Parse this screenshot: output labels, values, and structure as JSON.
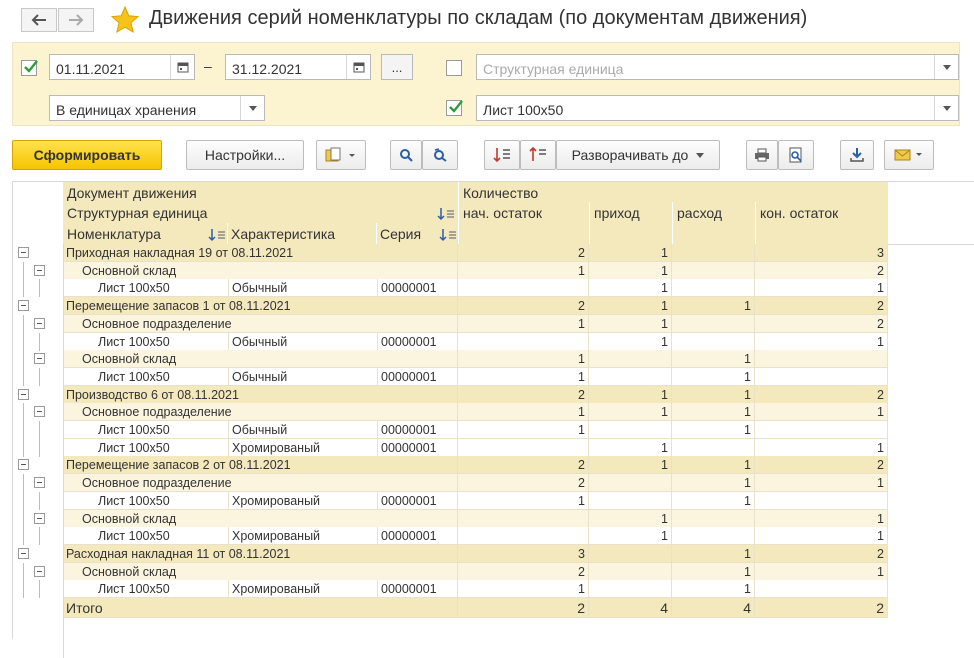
{
  "window": {
    "title": "Движения серий номенклатуры по складам (по документам движения)"
  },
  "filters": {
    "period_enabled": true,
    "date_from": "01.11.2021",
    "date_to": "31.12.2021",
    "period_dash": "–",
    "period_button": "...",
    "units": "В единицах хранения",
    "structural_unit_enabled": false,
    "structural_unit_placeholder": "Структурная единица",
    "item_enabled": true,
    "item_value": "Лист 100х50"
  },
  "toolbar": {
    "generate": "Сформировать",
    "settings": "Настройки...",
    "expand_to": "Разворачивать до"
  },
  "report": {
    "headers": {
      "document": "Документ движения",
      "structural_unit": "Структурная единица",
      "nomenclature": "Номенклатура",
      "characteristic": "Характеристика",
      "series": "Серия",
      "quantity": "Количество",
      "start_balance": "нач. остаток",
      "income": "приход",
      "expense": "расход",
      "end_balance": "кон. остаток"
    },
    "rows": [
      {
        "level": 0,
        "name": "Приходная накладная 19 от 08.11.2021",
        "char": "",
        "series": "",
        "start": "2",
        "income": "1",
        "expense": "",
        "end": "3"
      },
      {
        "level": 1,
        "name": "Основной склад",
        "char": "",
        "series": "",
        "start": "1",
        "income": "1",
        "expense": "",
        "end": "2"
      },
      {
        "level": 2,
        "name": "Лист 100х50",
        "char": "Обычный",
        "series": "00000001",
        "start": "",
        "income": "1",
        "expense": "",
        "end": "1"
      },
      {
        "level": 0,
        "name": "Перемещение запасов 1 от 08.11.2021",
        "char": "",
        "series": "",
        "start": "2",
        "income": "1",
        "expense": "1",
        "end": "2"
      },
      {
        "level": 1,
        "name": "Основное подразделение",
        "char": "",
        "series": "",
        "start": "1",
        "income": "1",
        "expense": "",
        "end": "2"
      },
      {
        "level": 2,
        "name": "Лист 100х50",
        "char": "Обычный",
        "series": "00000001",
        "start": "",
        "income": "1",
        "expense": "",
        "end": "1"
      },
      {
        "level": 1,
        "name": "Основной склад",
        "char": "",
        "series": "",
        "start": "1",
        "income": "",
        "expense": "1",
        "end": ""
      },
      {
        "level": 2,
        "name": "Лист 100х50",
        "char": "Обычный",
        "series": "00000001",
        "start": "1",
        "income": "",
        "expense": "1",
        "end": ""
      },
      {
        "level": 0,
        "name": "Производство 6 от 08.11.2021",
        "char": "",
        "series": "",
        "start": "2",
        "income": "1",
        "expense": "1",
        "end": "2"
      },
      {
        "level": 1,
        "name": "Основное подразделение",
        "char": "",
        "series": "",
        "start": "1",
        "income": "1",
        "expense": "1",
        "end": "1"
      },
      {
        "level": 2,
        "name": "Лист 100х50",
        "char": "Обычный",
        "series": "00000001",
        "start": "1",
        "income": "",
        "expense": "1",
        "end": ""
      },
      {
        "level": 2,
        "name": "Лист 100х50",
        "char": "Хромированый",
        "series": "00000001",
        "start": "",
        "income": "1",
        "expense": "",
        "end": "1"
      },
      {
        "level": 0,
        "name": "Перемещение запасов 2 от 08.11.2021",
        "char": "",
        "series": "",
        "start": "2",
        "income": "1",
        "expense": "1",
        "end": "2"
      },
      {
        "level": 1,
        "name": "Основное подразделение",
        "char": "",
        "series": "",
        "start": "2",
        "income": "",
        "expense": "1",
        "end": "1"
      },
      {
        "level": 2,
        "name": "Лист 100х50",
        "char": "Хромированый",
        "series": "00000001",
        "start": "1",
        "income": "",
        "expense": "1",
        "end": ""
      },
      {
        "level": 1,
        "name": "Основной склад",
        "char": "",
        "series": "",
        "start": "",
        "income": "1",
        "expense": "",
        "end": "1"
      },
      {
        "level": 2,
        "name": "Лист 100х50",
        "char": "Хромированый",
        "series": "00000001",
        "start": "",
        "income": "1",
        "expense": "",
        "end": "1"
      },
      {
        "level": 0,
        "name": "Расходная накладная 11 от 08.11.2021",
        "char": "",
        "series": "",
        "start": "3",
        "income": "",
        "expense": "1",
        "end": "2"
      },
      {
        "level": 1,
        "name": "Основной склад",
        "char": "",
        "series": "",
        "start": "2",
        "income": "",
        "expense": "1",
        "end": "1"
      },
      {
        "level": 2,
        "name": "Лист 100х50",
        "char": "Хромированый",
        "series": "00000001",
        "start": "1",
        "income": "",
        "expense": "1",
        "end": ""
      }
    ],
    "total": {
      "label": "Итого",
      "start": "2",
      "income": "4",
      "expense": "4",
      "end": "2"
    }
  }
}
